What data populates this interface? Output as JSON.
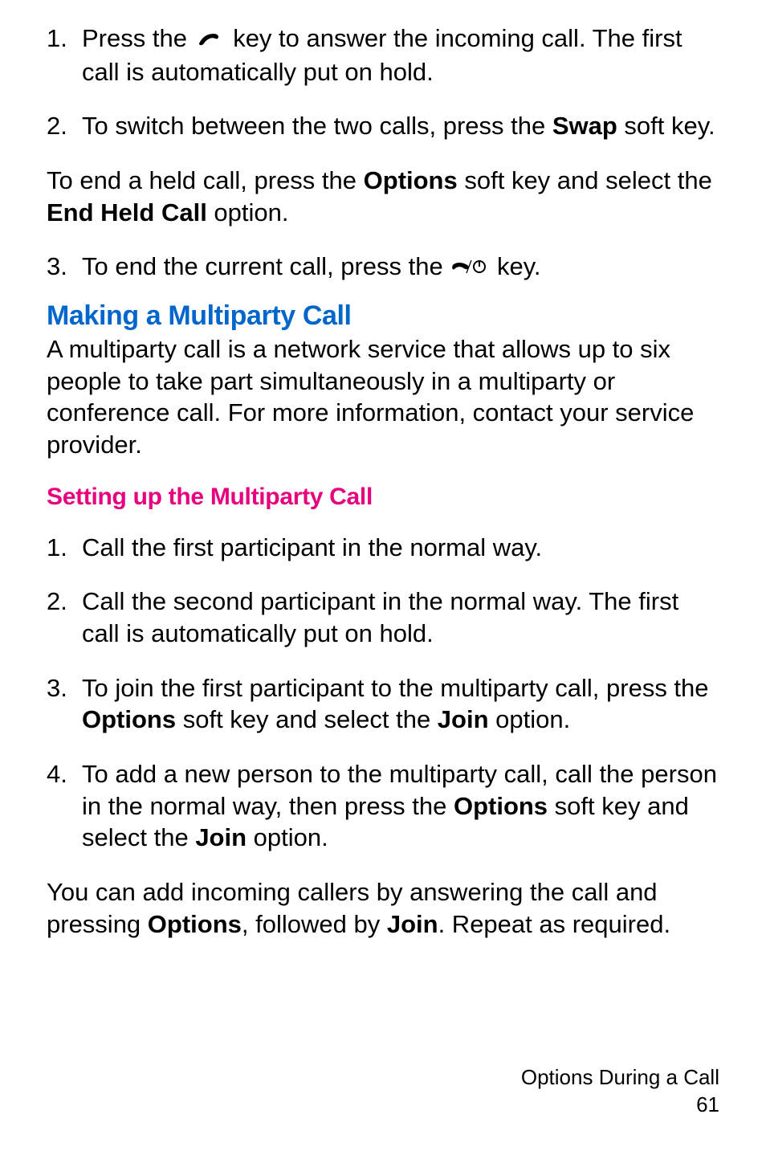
{
  "step1": {
    "num": "1.",
    "pre": "Press the ",
    "post": " key to answer the incoming call. The first call is automatically put on hold."
  },
  "step2": {
    "num": "2.",
    "pre": "To switch between the two calls, press the ",
    "bold": "Swap",
    "post": " soft key."
  },
  "para_endheld": {
    "pre": "To end a held call, press the ",
    "b1": "Options",
    "mid": " soft key and select the ",
    "b2": "End Held Call",
    "post": " option."
  },
  "step3": {
    "num": "3.",
    "pre": "To end the current call, press the ",
    "post": " key."
  },
  "h2_multiparty": "Making a Multiparty Call",
  "para_multiparty": "A multiparty call is a network service that allows up to six people to take part simultaneously in a multiparty or conference call. For more information, contact your service provider.",
  "h3_setup": "Setting up the Multiparty Call",
  "mstep1": {
    "num": "1.",
    "text": "Call the first participant in the normal way."
  },
  "mstep2": {
    "num": "2.",
    "text": "Call the second participant in the normal way. The first call is automatically put on hold."
  },
  "mstep3": {
    "num": "3.",
    "pre": "To join the first participant to the multiparty call, press the ",
    "b1": "Options",
    "mid": " soft key and select the ",
    "b2": "Join",
    "post": " option."
  },
  "mstep4": {
    "num": "4.",
    "pre": "To add a new person to the multiparty call, call the person in the normal way, then press the ",
    "b1": "Options",
    "mid": " soft key and select the ",
    "b2": "Join",
    "post": " option."
  },
  "para_addincoming": {
    "pre": "You can add incoming callers by answering the call and pressing ",
    "b1": "Options",
    "mid": ", followed by ",
    "b2": "Join",
    "post": ". Repeat as required."
  },
  "footer": {
    "title": "Options During a Call",
    "page": "61"
  }
}
